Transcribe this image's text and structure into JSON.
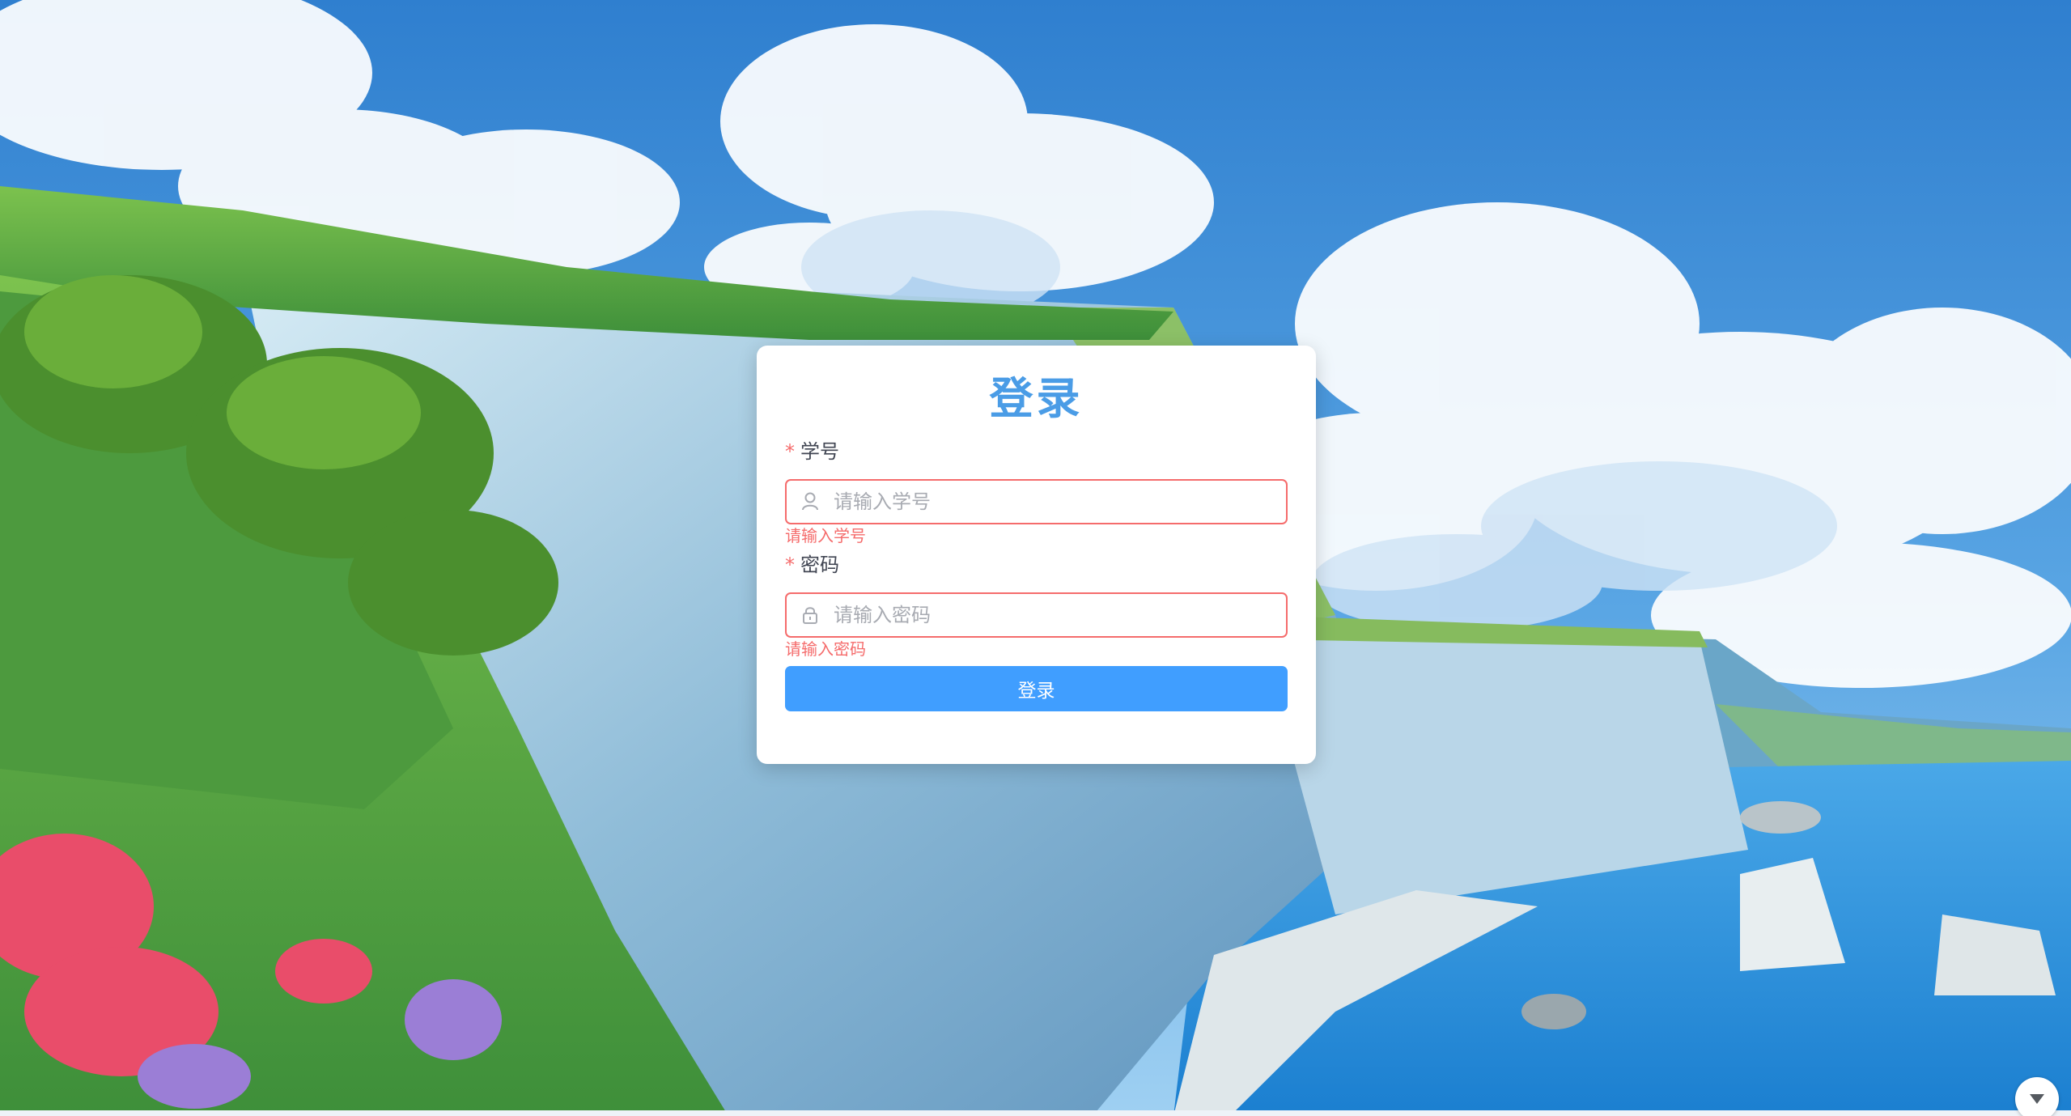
{
  "login": {
    "title": "登录",
    "student_id": {
      "label": "学号",
      "required_mark": "*",
      "placeholder": "请输入学号",
      "value": "",
      "error": "请输入学号",
      "icon": "user-icon"
    },
    "password": {
      "label": "密码",
      "required_mark": "*",
      "placeholder": "请输入密码",
      "value": "",
      "error": "请输入密码",
      "icon": "lock-icon"
    },
    "submit_label": "登录"
  },
  "floating_button": {
    "icon": "chevron-down-icon"
  },
  "colors": {
    "accent": "#409eff",
    "title": "#4a9ce6",
    "error": "#f56c6c"
  }
}
